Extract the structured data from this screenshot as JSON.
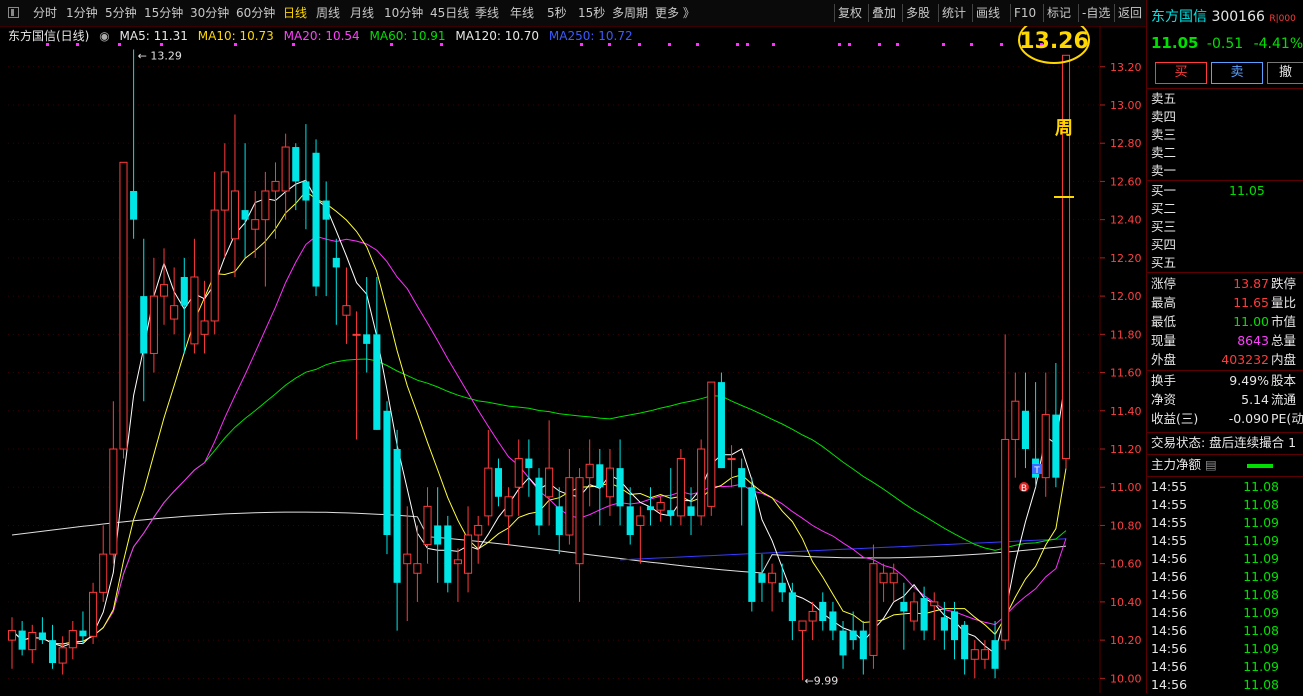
{
  "toolbar": {
    "left_items": [
      "分时",
      "1分钟",
      "5分钟",
      "15分钟",
      "30分钟",
      "60分钟",
      "日线",
      "周线",
      "月线",
      "10分钟",
      "45日线",
      "季线",
      "年线",
      "5秒",
      "15秒",
      "多周期",
      "更多 》"
    ],
    "active": "日线",
    "right_items": [
      "复权",
      "叠加",
      "多股",
      "统计",
      "画线",
      "F10",
      "标记",
      "-自选",
      "返回"
    ]
  },
  "legend": {
    "title": "东方国信(日线)",
    "ma5": "MA5: 11.31",
    "ma10": "MA10: 10.73",
    "ma20": "MA20: 10.54",
    "ma60": "MA60: 10.91",
    "ma120": "MA120: 10.70",
    "ma250": "MA250: 10.72"
  },
  "annotations": {
    "high_label": "13.29",
    "low_label": "9.99",
    "circled_value": "13.26",
    "week_label": "周",
    "b_marker": "B",
    "t_marker": "T"
  },
  "colors": {
    "up": "#ff3b3b",
    "down": "#00e5e5",
    "ma5": "#ffffff",
    "ma10": "#ffff3a",
    "ma20": "#ff30ff",
    "ma60": "#00e000",
    "ma120": "#e0e0e0",
    "ma250": "#3a3aff",
    "highlight": "#ffd700"
  },
  "chart_data": {
    "type": "candlestick",
    "y_ticks": [
      "13.20",
      "13.00",
      "12.80",
      "12.60",
      "12.40",
      "12.20",
      "12.00",
      "11.80",
      "11.60",
      "11.40",
      "11.20",
      "11.00",
      "10.80",
      "10.60",
      "10.40",
      "10.20",
      "10.00"
    ],
    "ylim": [
      9.96,
      13.34
    ],
    "candles": [
      [
        10.2,
        10.32,
        10.05,
        10.25
      ],
      [
        10.25,
        10.3,
        10.12,
        10.15
      ],
      [
        10.15,
        10.28,
        10.08,
        10.24
      ],
      [
        10.24,
        10.32,
        10.18,
        10.2
      ],
      [
        10.2,
        10.28,
        10.05,
        10.08
      ],
      [
        10.08,
        10.22,
        10.02,
        10.16
      ],
      [
        10.16,
        10.3,
        10.1,
        10.25
      ],
      [
        10.25,
        10.35,
        10.18,
        10.22
      ],
      [
        10.22,
        10.5,
        10.18,
        10.45
      ],
      [
        10.45,
        10.8,
        10.4,
        10.65
      ],
      [
        10.65,
        11.45,
        10.6,
        11.2
      ],
      [
        11.2,
        12.7,
        11.15,
        12.7
      ],
      [
        12.55,
        13.29,
        12.3,
        12.4
      ],
      [
        12.0,
        12.3,
        11.45,
        11.7
      ],
      [
        11.7,
        12.2,
        11.6,
        12.0
      ],
      [
        12.0,
        12.25,
        11.85,
        12.06
      ],
      [
        11.88,
        12.15,
        11.8,
        11.95
      ],
      [
        12.1,
        12.2,
        11.7,
        11.95
      ],
      [
        11.75,
        12.3,
        11.7,
        12.1
      ],
      [
        11.8,
        12.08,
        11.7,
        11.87
      ],
      [
        11.87,
        12.65,
        11.8,
        12.45
      ],
      [
        12.45,
        12.8,
        12.2,
        12.65
      ],
      [
        12.3,
        12.95,
        12.1,
        12.55
      ],
      [
        12.45,
        12.8,
        12.2,
        12.4
      ],
      [
        12.35,
        12.55,
        12.2,
        12.4
      ],
      [
        12.4,
        12.65,
        12.05,
        12.55
      ],
      [
        12.55,
        12.7,
        12.3,
        12.6
      ],
      [
        12.55,
        12.85,
        12.4,
        12.78
      ],
      [
        12.78,
        12.8,
        12.45,
        12.6
      ],
      [
        12.6,
        12.9,
        12.35,
        12.5
      ],
      [
        12.75,
        12.82,
        12.0,
        12.05
      ],
      [
        12.5,
        12.6,
        12.0,
        12.4
      ],
      [
        12.2,
        12.3,
        11.85,
        12.15
      ],
      [
        11.9,
        12.15,
        11.75,
        11.95
      ],
      [
        11.8,
        11.92,
        11.25,
        11.8
      ],
      [
        11.8,
        12.1,
        11.6,
        11.75
      ],
      [
        11.8,
        12.1,
        11.3,
        11.3
      ],
      [
        11.4,
        11.45,
        10.65,
        10.75
      ],
      [
        11.2,
        11.3,
        10.25,
        10.5
      ],
      [
        10.6,
        10.9,
        10.3,
        10.65
      ],
      [
        10.55,
        10.8,
        10.4,
        10.6
      ],
      [
        10.7,
        11.0,
        10.6,
        10.9
      ],
      [
        10.8,
        11.0,
        10.5,
        10.7
      ],
      [
        10.8,
        10.85,
        10.45,
        10.5
      ],
      [
        10.6,
        10.68,
        10.4,
        10.62
      ],
      [
        10.55,
        10.9,
        10.45,
        10.75
      ],
      [
        10.75,
        10.85,
        10.6,
        10.8
      ],
      [
        10.85,
        11.3,
        10.8,
        11.1
      ],
      [
        11.1,
        11.15,
        10.9,
        10.95
      ],
      [
        10.85,
        11.0,
        10.7,
        10.95
      ],
      [
        11.0,
        11.25,
        10.85,
        11.15
      ],
      [
        11.15,
        11.25,
        10.95,
        11.1
      ],
      [
        11.05,
        11.1,
        10.75,
        10.8
      ],
      [
        10.95,
        11.35,
        10.8,
        11.1
      ],
      [
        10.9,
        11.0,
        10.65,
        10.75
      ],
      [
        10.75,
        11.2,
        10.7,
        11.05
      ],
      [
        10.6,
        11.1,
        10.4,
        11.05
      ],
      [
        11.05,
        11.25,
        10.9,
        11.12
      ],
      [
        11.12,
        11.2,
        10.8,
        11.0
      ],
      [
        10.95,
        11.2,
        10.85,
        11.1
      ],
      [
        11.1,
        11.25,
        10.8,
        10.9
      ],
      [
        10.9,
        11.0,
        10.7,
        10.75
      ],
      [
        10.8,
        10.9,
        10.6,
        10.85
      ],
      [
        10.9,
        11.0,
        10.8,
        10.88
      ],
      [
        10.88,
        10.95,
        10.82,
        10.92
      ],
      [
        10.88,
        11.1,
        10.8,
        10.85
      ],
      [
        10.85,
        11.2,
        10.8,
        11.15
      ],
      [
        10.9,
        11.0,
        10.75,
        10.85
      ],
      [
        10.85,
        11.25,
        10.8,
        11.2
      ],
      [
        10.9,
        11.55,
        10.85,
        11.55
      ],
      [
        11.55,
        11.6,
        11.1,
        11.1
      ],
      [
        11.15,
        11.22,
        11.0,
        11.15
      ],
      [
        11.1,
        11.15,
        10.8,
        11.0
      ],
      [
        11.0,
        11.05,
        10.35,
        10.4
      ],
      [
        10.55,
        10.65,
        10.4,
        10.5
      ],
      [
        10.5,
        10.6,
        10.35,
        10.55
      ],
      [
        10.5,
        10.6,
        10.4,
        10.45
      ],
      [
        10.45,
        10.5,
        10.2,
        10.3
      ],
      [
        10.25,
        10.3,
        9.99,
        10.3
      ],
      [
        10.3,
        10.4,
        10.2,
        10.35
      ],
      [
        10.4,
        10.45,
        10.25,
        10.3
      ],
      [
        10.35,
        10.4,
        10.2,
        10.25
      ],
      [
        10.25,
        10.3,
        10.05,
        10.12
      ],
      [
        10.25,
        10.35,
        10.15,
        10.2
      ],
      [
        10.25,
        10.3,
        10.02,
        10.1
      ],
      [
        10.12,
        10.7,
        10.05,
        10.6
      ],
      [
        10.5,
        10.6,
        10.4,
        10.55
      ],
      [
        10.5,
        10.6,
        10.4,
        10.55
      ],
      [
        10.4,
        10.5,
        10.15,
        10.35
      ],
      [
        10.3,
        10.45,
        10.25,
        10.4
      ],
      [
        10.42,
        10.48,
        10.2,
        10.25
      ],
      [
        10.38,
        10.45,
        10.2,
        10.4
      ],
      [
        10.32,
        10.4,
        10.15,
        10.25
      ],
      [
        10.35,
        10.4,
        10.1,
        10.2
      ],
      [
        10.28,
        10.3,
        10.02,
        10.1
      ],
      [
        10.1,
        10.2,
        10.0,
        10.15
      ],
      [
        10.1,
        10.2,
        10.05,
        10.15
      ],
      [
        10.2,
        10.3,
        10.0,
        10.05
      ],
      [
        10.2,
        11.8,
        10.15,
        11.25
      ],
      [
        11.25,
        11.6,
        11.05,
        11.45
      ],
      [
        11.4,
        11.6,
        11.1,
        11.2
      ],
      [
        11.15,
        11.55,
        11.0,
        11.05
      ],
      [
        11.05,
        11.6,
        10.95,
        11.38
      ],
      [
        11.38,
        11.65,
        11.0,
        11.05
      ],
      [
        11.15,
        13.26,
        11.1,
        13.26
      ]
    ]
  },
  "quote_panel": {
    "name": "东方国信",
    "code": "300166",
    "tag": "R|000",
    "price": "11.05",
    "change": "-0.51",
    "pct": "-4.41%",
    "buy": "买",
    "sell": "卖",
    "cancel": "撤",
    "sell_levels": [
      "卖五",
      "卖四",
      "卖三",
      "卖二",
      "卖一"
    ],
    "buy_levels": [
      "买一",
      "买二",
      "买三",
      "买四",
      "买五"
    ],
    "buy1_price": "11.05",
    "stats": [
      {
        "label": "涨停",
        "value": "13.87",
        "right": "跌停",
        "cls": "red"
      },
      {
        "label": "最高",
        "value": "11.65",
        "right": "量比",
        "cls": "red"
      },
      {
        "label": "最低",
        "value": "11.00",
        "right": "市值",
        "cls": "green"
      },
      {
        "label": "现量",
        "value": "8643",
        "right": "总量",
        "cls": "magenta"
      },
      {
        "label": "外盘",
        "value": "403232",
        "right": "内盘",
        "cls": "red"
      }
    ],
    "stats2": [
      {
        "label": "换手",
        "value": "9.49%",
        "right": "股本"
      },
      {
        "label": "净资",
        "value": "5.14",
        "right": "流通"
      },
      {
        "label": "收益(三)",
        "value": "-0.090",
        "right": "PE(动"
      }
    ],
    "trade_status": "交易状态: 盘后连续撮合 1",
    "net_label": "主力净额",
    "ticks": [
      {
        "t": "14:55",
        "p": "11.08"
      },
      {
        "t": "14:55",
        "p": "11.08"
      },
      {
        "t": "14:55",
        "p": "11.09"
      },
      {
        "t": "14:55",
        "p": "11.09"
      },
      {
        "t": "14:56",
        "p": "11.09"
      },
      {
        "t": "14:56",
        "p": "11.09"
      },
      {
        "t": "14:56",
        "p": "11.08"
      },
      {
        "t": "14:56",
        "p": "11.09"
      },
      {
        "t": "14:56",
        "p": "11.08"
      },
      {
        "t": "14:56",
        "p": "11.09"
      },
      {
        "t": "14:56",
        "p": "11.09"
      },
      {
        "t": "14:56",
        "p": "11.08"
      }
    ]
  }
}
